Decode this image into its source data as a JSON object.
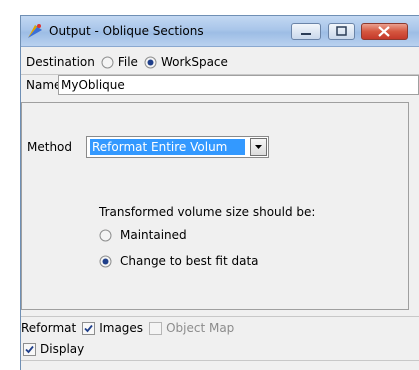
{
  "window": {
    "title": "Output - Oblique Sections"
  },
  "destination": {
    "label": "Destination",
    "options": [
      {
        "label": "File",
        "selected": false
      },
      {
        "label": "WorkSpace",
        "selected": true
      }
    ]
  },
  "name": {
    "label": "Name",
    "value": "MyOblique"
  },
  "method": {
    "label": "Method",
    "selected_value": "Reformat Entire Volum",
    "transform_label": "Transformed volume size should be:",
    "options": [
      {
        "label": "Maintained",
        "selected": false
      },
      {
        "label": "Change to best fit data",
        "selected": true
      }
    ]
  },
  "reformat": {
    "label": "Reformat",
    "images_label": "Images",
    "images_checked": true,
    "object_map_label": "Object Map",
    "object_map_checked": false,
    "object_map_enabled": false
  },
  "display": {
    "label": "Display",
    "checked": true
  },
  "colors": {
    "selection": "#3399ff",
    "titlebar": "#a9c6ea",
    "close_button": "#c5392a"
  }
}
